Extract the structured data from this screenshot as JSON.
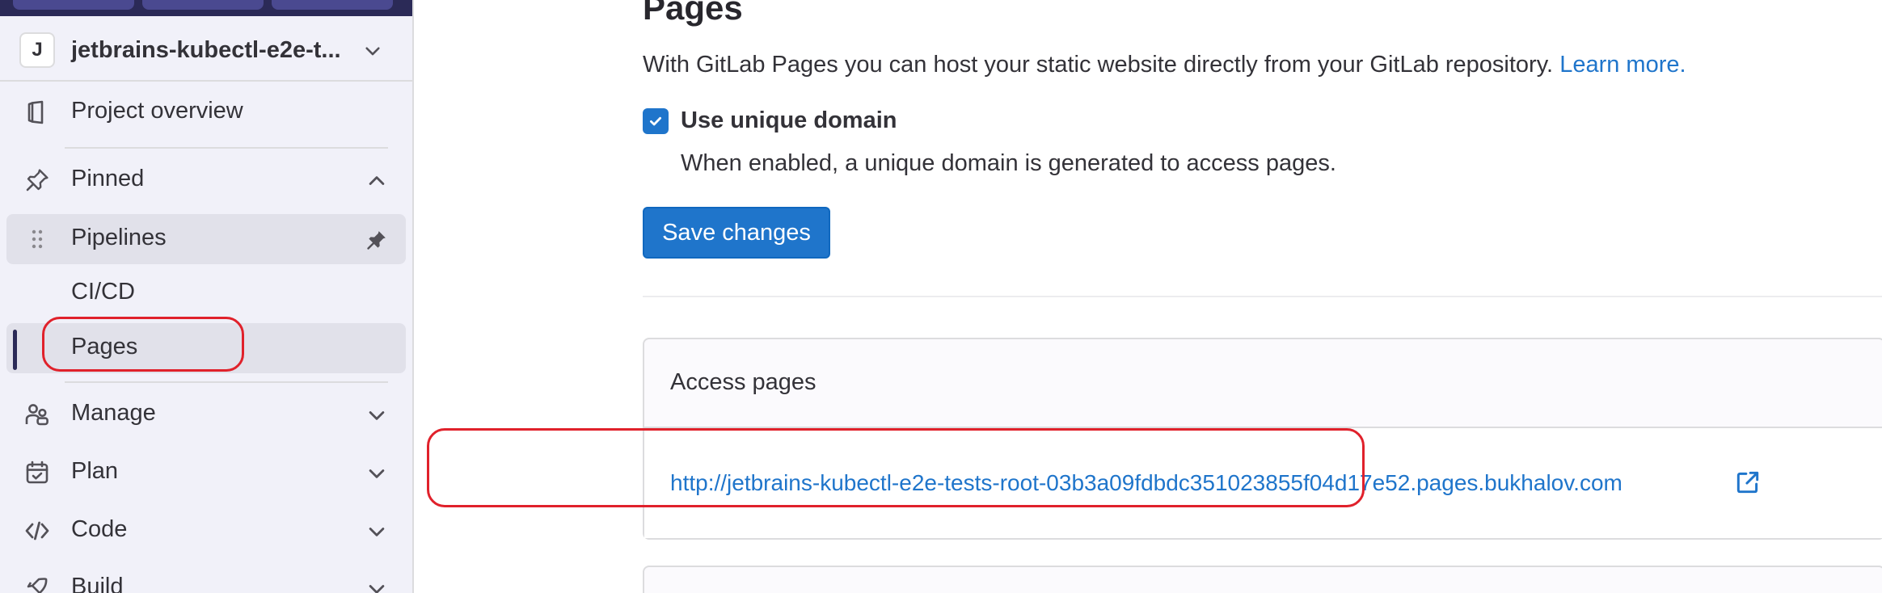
{
  "sidebar": {
    "project": {
      "avatar_letter": "J",
      "name": "jetbrains-kubectl-e2e-t..."
    },
    "items": {
      "project_overview": {
        "label": "Project overview",
        "icon": "project-overview-icon"
      },
      "pinned": {
        "label": "Pinned",
        "icon": "pin-icon",
        "expanded": true
      },
      "pipelines": {
        "label": "Pipelines",
        "icon": "drag-handle-icon"
      },
      "cicd": {
        "label": "CI/CD"
      },
      "pages": {
        "label": "Pages",
        "active": true
      },
      "manage": {
        "label": "Manage",
        "icon": "users-icon"
      },
      "plan": {
        "label": "Plan",
        "icon": "calendar-icon"
      },
      "code": {
        "label": "Code",
        "icon": "code-icon"
      },
      "build": {
        "label": "Build",
        "icon": "rocket-icon"
      }
    }
  },
  "main": {
    "title": "Pages",
    "description": "With GitLab Pages you can host your static website directly from your GitLab repository.",
    "learn_more": "Learn more.",
    "unique_domain": {
      "label": "Use unique domain",
      "checked": true,
      "help": "When enabled, a unique domain is generated to access pages."
    },
    "save_button": "Save changes",
    "access_pages": {
      "title": "Access pages",
      "url": "http://jetbrains-kubectl-e2e-tests-root-03b3a09fdbdc351023855f04d17e52.pages.bukhalov.com"
    }
  },
  "colors": {
    "sidebar_bg": "#f1f1f9",
    "accent_blue": "#1f75cb",
    "highlight_red": "#e0212b",
    "topbar": "#2b2a57"
  }
}
